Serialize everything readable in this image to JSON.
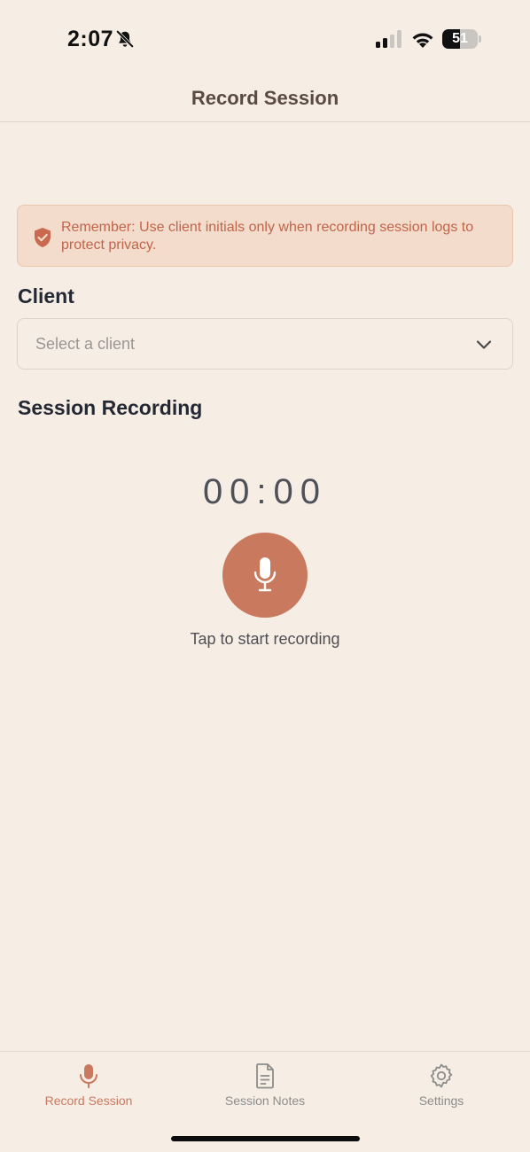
{
  "status_bar": {
    "time": "2:07",
    "battery": "51",
    "battery_level": 0.51
  },
  "header": {
    "title": "Record Session"
  },
  "banner": {
    "icon": "shield-check-icon",
    "text": "Remember: Use client initials only when recording session logs to protect privacy."
  },
  "client": {
    "label": "Client",
    "placeholder": "Select a client"
  },
  "recording": {
    "label": "Session Recording",
    "timer": "00:00",
    "hint": "Tap to start recording"
  },
  "tabs": [
    {
      "label": "Record Session",
      "icon": "microphone-icon",
      "active": true
    },
    {
      "label": "Session Notes",
      "icon": "document-icon",
      "active": false
    },
    {
      "label": "Settings",
      "icon": "gear-icon",
      "active": false
    }
  ],
  "colors": {
    "background": "#f6ede5",
    "accent": "#c97a5e",
    "banner_bg": "#f3dccb",
    "banner_text": "#c0654c",
    "inactive_tab": "#8b8d8a"
  }
}
